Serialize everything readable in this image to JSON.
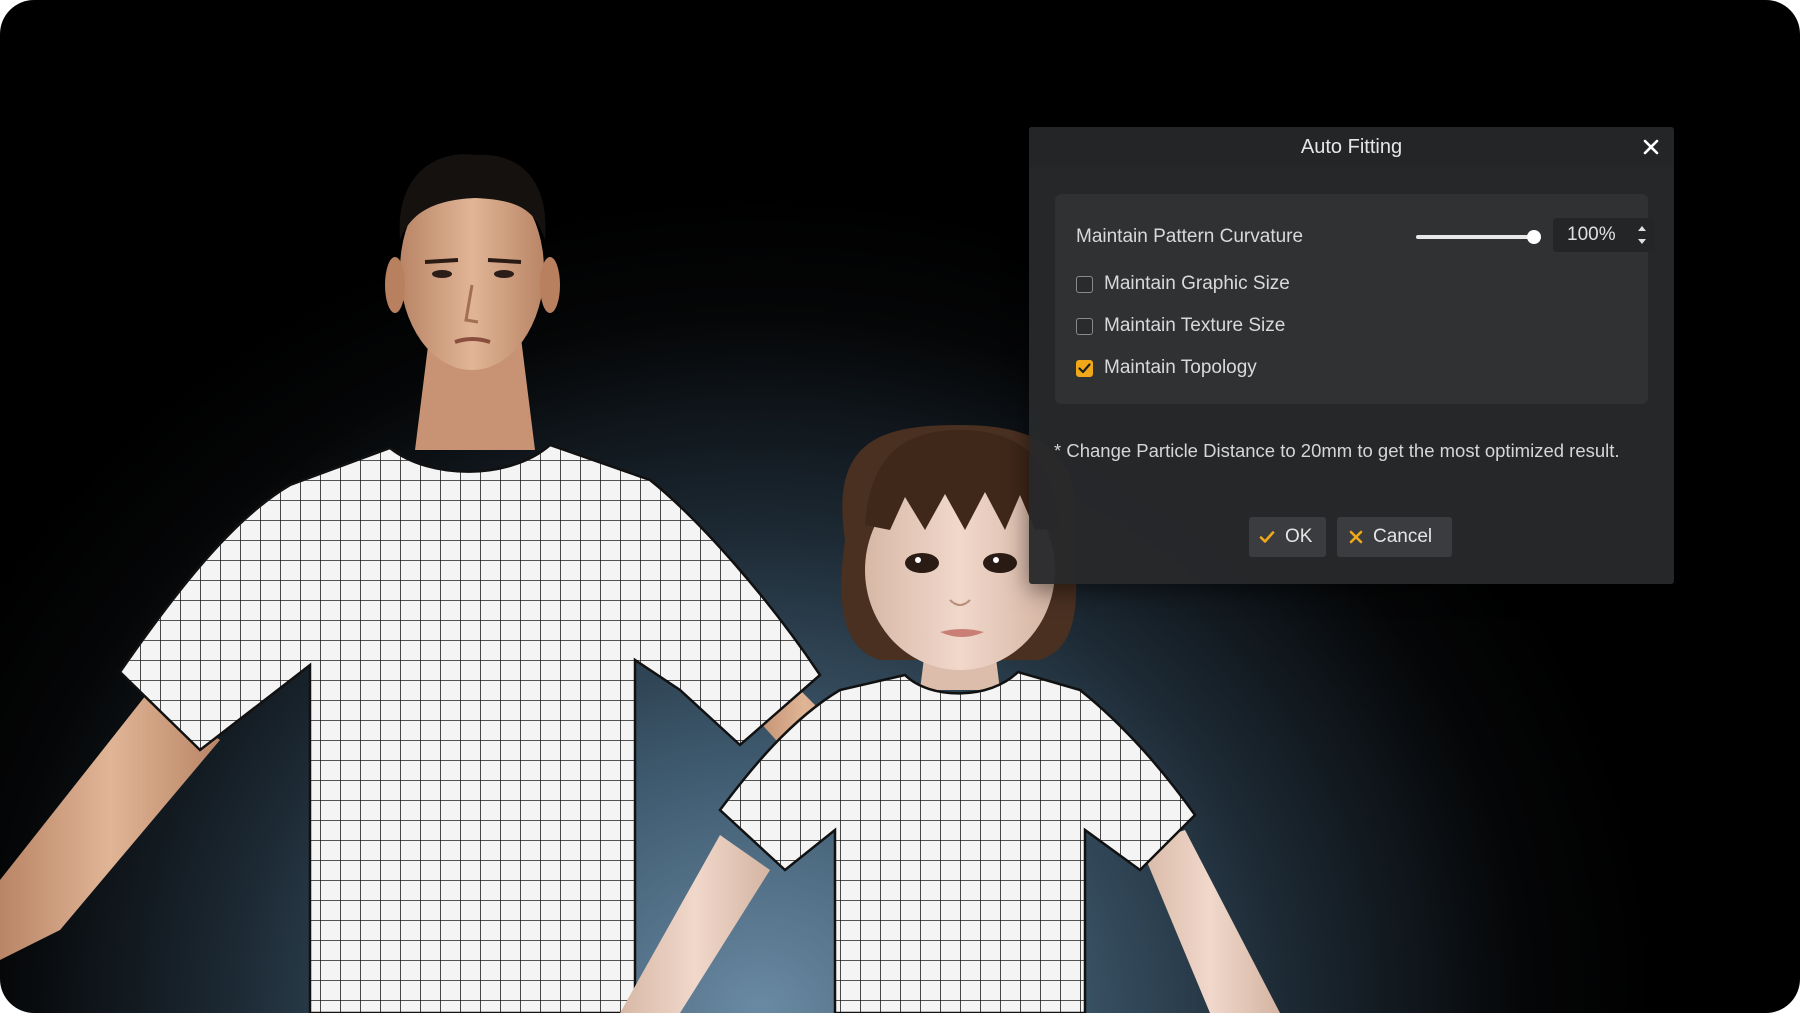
{
  "dialog": {
    "title": "Auto Fitting",
    "close_icon": "close-icon",
    "options": {
      "curvature_label": "Maintain Pattern Curvature",
      "curvature_value": "100%",
      "curvature_level": 1.0,
      "checkboxes": [
        {
          "label": "Maintain Graphic Size",
          "checked": false
        },
        {
          "label": "Maintain Texture Size",
          "checked": false
        },
        {
          "label": "Maintain Topology",
          "checked": true
        }
      ]
    },
    "note": "* Change Particle Distance to 20mm to get the most optimized result.",
    "ok_label": "OK",
    "cancel_label": "Cancel"
  },
  "colors": {
    "accent": "#f0a719",
    "dialog_bg": "#28292b",
    "panel_bg": "#303133"
  }
}
